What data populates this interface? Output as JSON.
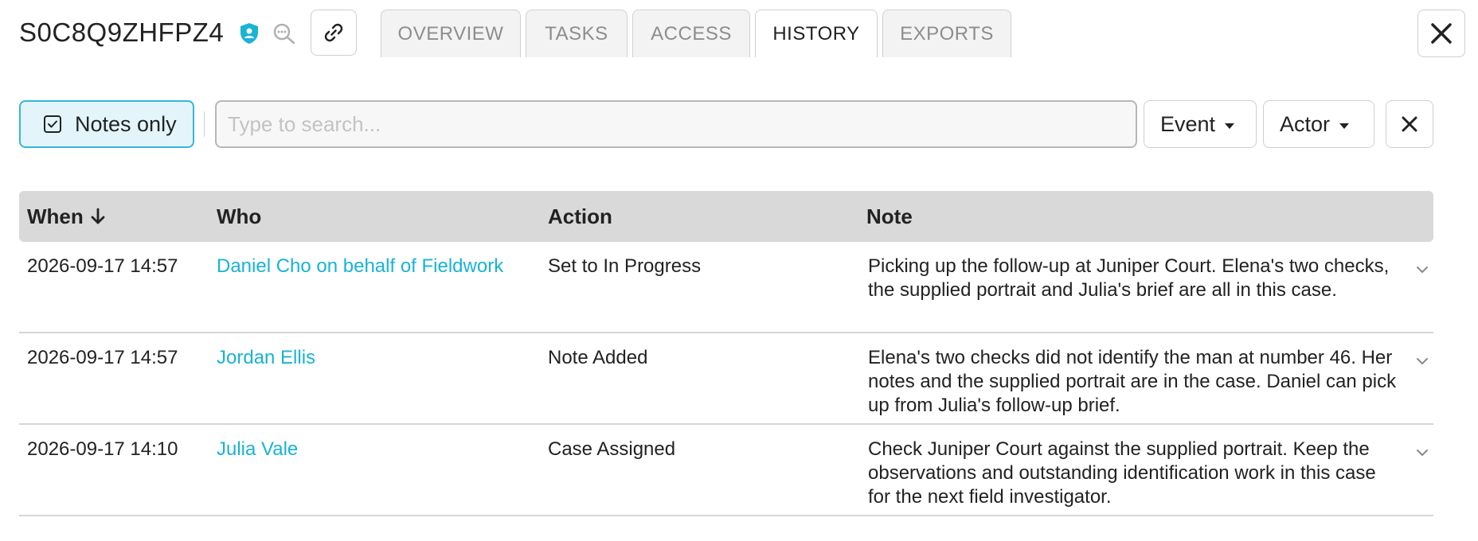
{
  "header": {
    "case_id": "S0C8Q9ZHFPZ4",
    "tabs": [
      {
        "label": "OVERVIEW",
        "active": false
      },
      {
        "label": "TASKS",
        "active": false
      },
      {
        "label": "ACCESS",
        "active": false
      },
      {
        "label": "HISTORY",
        "active": true
      },
      {
        "label": "EXPORTS",
        "active": false
      }
    ]
  },
  "filters": {
    "notes_only_label": "Notes only",
    "notes_only_checked": true,
    "search_placeholder": "Type to search...",
    "search_value": "",
    "event_label": "Event",
    "actor_label": "Actor"
  },
  "table": {
    "columns": [
      "When",
      "Who",
      "Action",
      "Note"
    ],
    "sort_column": "When",
    "sort_direction": "descending",
    "rows": [
      {
        "when": "2026-09-17 14:57",
        "who": "Daniel Cho on behalf of Fieldwork",
        "action": "Set to In Progress",
        "note": "Picking up the follow-up at Juniper Court. Elena's two checks, the supplied portrait and Julia's brief are all in this case."
      },
      {
        "when": "2026-09-17 14:57",
        "who": "Jordan Ellis",
        "action": "Note Added",
        "note": "Elena's two checks did not identify the man at number 46. Her notes and the supplied portrait are in the case. Daniel can pick up from Julia's follow-up brief."
      },
      {
        "when": "2026-09-17 14:10",
        "who": "Julia Vale",
        "action": "Case Assigned",
        "note": "Check Juniper Court against the supplied portrait. Keep the observations and outstanding identification work in this case for the next field investigator."
      }
    ]
  },
  "colors": {
    "accent": "#35b7d8",
    "link": "#19b3d4",
    "header_bg": "#d9d9d9",
    "toggle_bg": "#e3f5fb"
  },
  "icons": [
    "shield-icon",
    "inspect-icon",
    "link-icon",
    "close-icon",
    "checkbox-icon",
    "caret-down-icon",
    "clear-icon",
    "arrow-down-icon",
    "chevron-down-icon"
  ]
}
